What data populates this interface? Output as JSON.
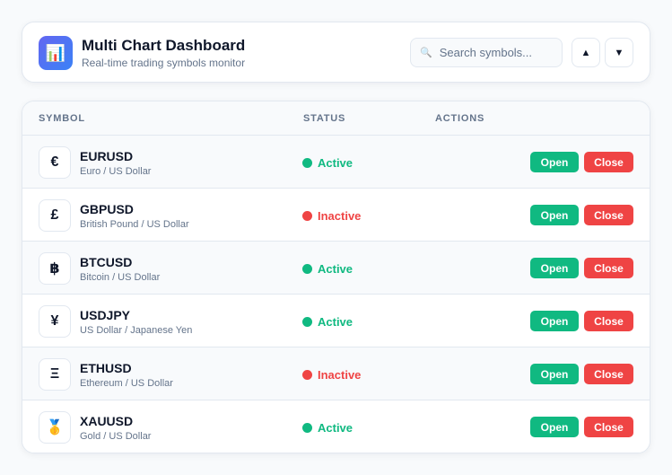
{
  "header": {
    "title": "Multi Chart Dashboard",
    "subtitle": "Real-time trading symbols monitor",
    "app_icon": "📊",
    "search_icon": "🔍",
    "search_placeholder": "Search symbols...",
    "search_value": "",
    "sort_up_label": "▲",
    "sort_down_label": "▼"
  },
  "table": {
    "columns": [
      "SYMBOL",
      "STATUS",
      "ACTIONS"
    ],
    "open_label": "Open",
    "close_label": "Close",
    "rows": [
      {
        "icon": "€",
        "icon_name": "euro-icon",
        "symbol": "EURUSD",
        "description": "Euro / US Dollar",
        "status": "Active"
      },
      {
        "icon": "£",
        "icon_name": "pound-icon",
        "symbol": "GBPUSD",
        "description": "British Pound / US Dollar",
        "status": "Inactive"
      },
      {
        "icon": "฿",
        "icon_name": "bitcoin-icon",
        "symbol": "BTCUSD",
        "description": "Bitcoin / US Dollar",
        "status": "Active"
      },
      {
        "icon": "¥",
        "icon_name": "yen-icon",
        "symbol": "USDJPY",
        "description": "US Dollar / Japanese Yen",
        "status": "Active"
      },
      {
        "icon": "Ξ",
        "icon_name": "ethereum-icon",
        "symbol": "ETHUSD",
        "description": "Ethereum / US Dollar",
        "status": "Inactive"
      },
      {
        "icon": "🥇",
        "icon_name": "gold-medal-icon",
        "symbol": "XAUUSD",
        "description": "Gold / US Dollar",
        "status": "Active"
      }
    ]
  },
  "colors": {
    "active": "#10b981",
    "inactive": "#ef4444",
    "accent": "#3b82f6"
  }
}
